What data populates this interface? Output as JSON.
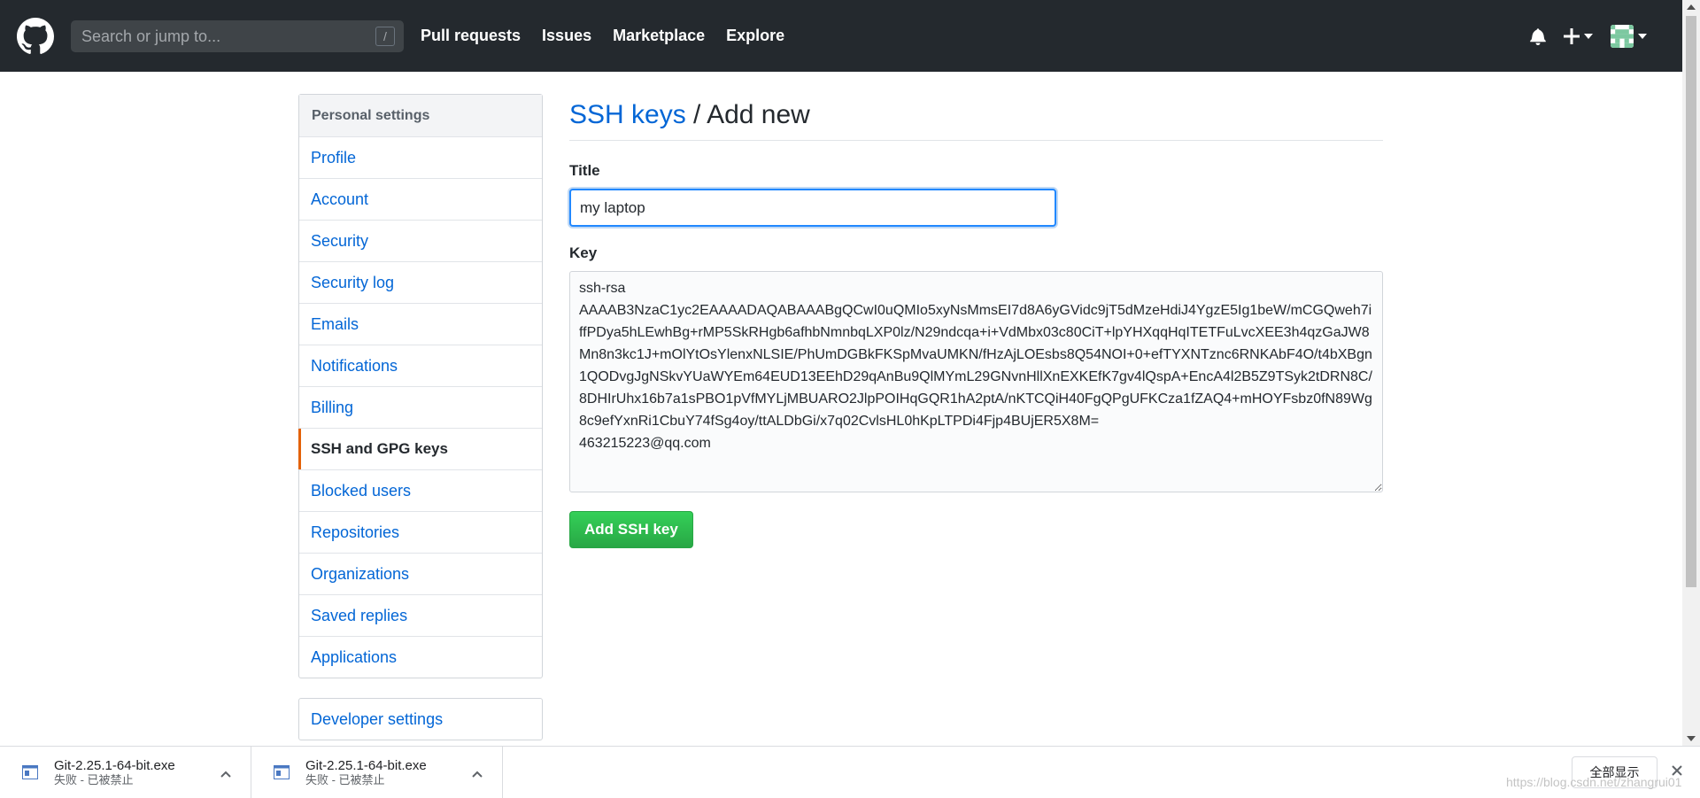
{
  "header": {
    "search_placeholder": "Search or jump to...",
    "search_shortcut": "/",
    "nav": [
      "Pull requests",
      "Issues",
      "Marketplace",
      "Explore"
    ]
  },
  "sidebar": {
    "heading": "Personal settings",
    "items": [
      {
        "label": "Profile"
      },
      {
        "label": "Account"
      },
      {
        "label": "Security"
      },
      {
        "label": "Security log"
      },
      {
        "label": "Emails"
      },
      {
        "label": "Notifications"
      },
      {
        "label": "Billing"
      },
      {
        "label": "SSH and GPG keys",
        "active": true
      },
      {
        "label": "Blocked users"
      },
      {
        "label": "Repositories"
      },
      {
        "label": "Organizations"
      },
      {
        "label": "Saved replies"
      },
      {
        "label": "Applications"
      }
    ],
    "developer_settings": "Developer settings"
  },
  "main": {
    "breadcrumb_link": "SSH keys",
    "breadcrumb_rest": " / Add new",
    "title_label": "Title",
    "title_value": "my laptop",
    "key_label": "Key",
    "key_value": "ssh-rsa\nAAAAB3NzaC1yc2EAAAADAQABAAABgQCwI0uQMIo5xyNsMmsEI7d8A6yGVidc9jT5dMzeHdiJ4YgzE5Ig1beW/mCGQweh7iffPDya5hLEwhBg+rMP5SkRHgb6afhbNmnbqLXP0lz/N29ndcqa+i+VdMbx03c80CiT+lpYHXqqHqITETFuLvcXEE3h4qzGaJW8Mn8n3kc1J+mOlYtOsYlenxNLSIE/PhUmDGBkFKSpMvaUMKN/fHzAjLOEsbs8Q54NOI+0+efTYXNTznc6RNKAbF4O/t4bXBgn1QODvgJgNSkvYUaWYEm64EUD13EEhD29qAnBu9QlMYmL29GNvnHllXnEXKEfK7gv4lQspA+EncA4l2B5Z9TSyk2tDRN8C/8DHIrUhx16b7a1sPBO1pVfMYLjMBUARO2JlpPOIHqGQR1hA2ptA/nKTCQiH40FgQPgUFKCza1fZAQ4+mHOYFsbz0fN89Wg8c9efYxnRi1CbuY74fSg4oy/ttALDbGi/x7q02CvlsHL0hKpLTPDi4Fjp4BUjER5X8M=\n463215223@qq.com",
    "submit_label": "Add SSH key"
  },
  "downloads": {
    "items": [
      {
        "name": "Git-2.25.1-64-bit.exe",
        "status": "失败 - 已被禁止"
      },
      {
        "name": "Git-2.25.1-64-bit.exe",
        "status": "失败 - 已被禁止"
      }
    ],
    "show_all": "全部显示",
    "watermark": "https://blog.csdn.net/zhangrui01"
  },
  "colors": {
    "header_bg": "#24292e",
    "link": "#0366d6",
    "active_marker": "#e36209",
    "button_green": "#28a745"
  }
}
